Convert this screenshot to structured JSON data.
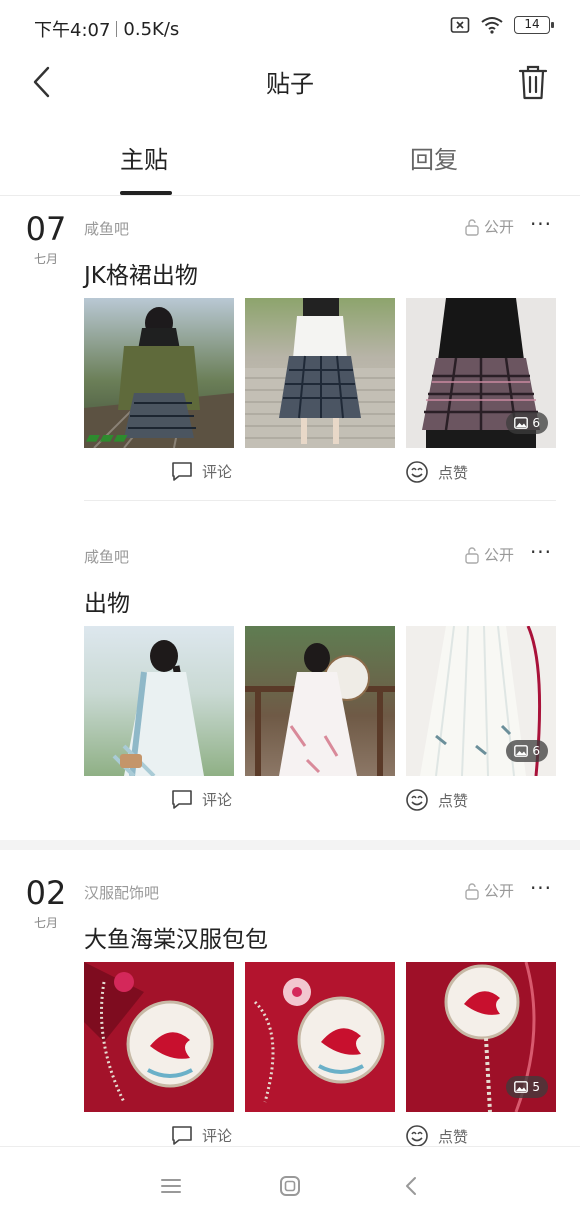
{
  "status": {
    "time": "下午4:07",
    "speed": "0.5K/s",
    "battery": "14"
  },
  "header": {
    "title": "贴子",
    "back_icon": "back-arrow-icon",
    "delete_icon": "trash-icon"
  },
  "tabs": [
    {
      "label": "主贴",
      "active": true
    },
    {
      "label": "回复",
      "active": false
    }
  ],
  "groups": [
    {
      "day": "07",
      "month": "七月",
      "posts": [
        {
          "forum": "咸鱼吧",
          "privacy": "公开",
          "more": "···",
          "title": "JK格裙出物",
          "image_count": "6",
          "comment_label": "评论",
          "like_label": "点赞"
        },
        {
          "forum": "咸鱼吧",
          "privacy": "公开",
          "more": "···",
          "title": "出物",
          "image_count": "6",
          "comment_label": "评论",
          "like_label": "点赞"
        }
      ]
    },
    {
      "day": "02",
      "month": "七月",
      "posts": [
        {
          "forum": "汉服配饰吧",
          "privacy": "公开",
          "more": "···",
          "title": "大鱼海棠汉服包包",
          "image_count": "5",
          "comment_label": "评论",
          "like_label": "点赞"
        }
      ]
    }
  ],
  "colors": {
    "text": "#222222",
    "muted": "#999999",
    "divider": "#ececec",
    "section_gap": "#f3f3f3"
  }
}
